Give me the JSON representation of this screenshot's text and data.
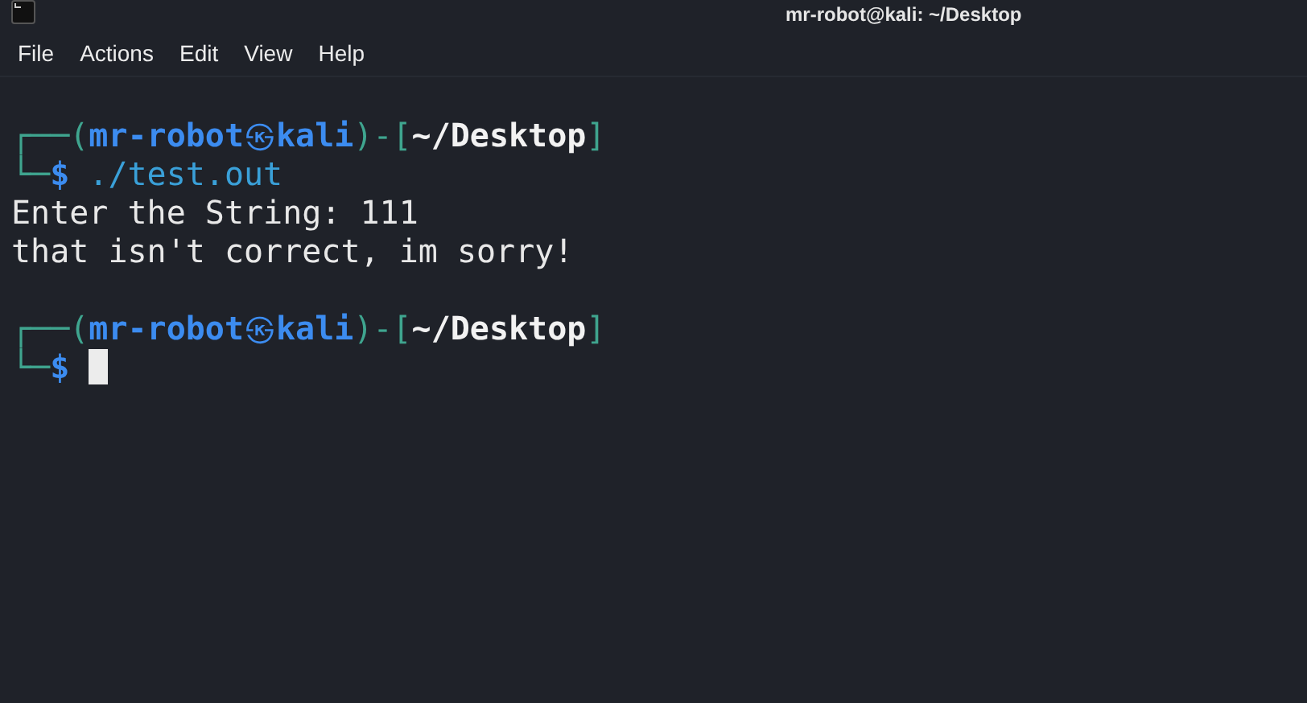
{
  "window": {
    "title": "mr-robot@kali: ~/Desktop"
  },
  "menu": [
    "File",
    "Actions",
    "Edit",
    "View",
    "Help"
  ],
  "terminal": {
    "lines": [
      {
        "kind": "prompt",
        "frame_open": "┌──(",
        "user": "mr-robot",
        "symbol": "㉿",
        "host": "kali",
        "separator": ")-[",
        "path": "~/Desktop",
        "frame_close": "]",
        "corner": "└─",
        "dollar": "$",
        "command": "./test.out",
        "cursor": false
      },
      {
        "kind": "output",
        "text": "Enter the String: 111"
      },
      {
        "kind": "output",
        "text": "that isn't correct, im sorry!"
      },
      {
        "kind": "blank"
      },
      {
        "kind": "prompt",
        "frame_open": "┌──(",
        "user": "mr-robot",
        "symbol": "㉿",
        "host": "kali",
        "separator": ")-[",
        "path": "~/Desktop",
        "frame_close": "]",
        "corner": "└─",
        "dollar": "$",
        "cursor": true
      }
    ]
  }
}
